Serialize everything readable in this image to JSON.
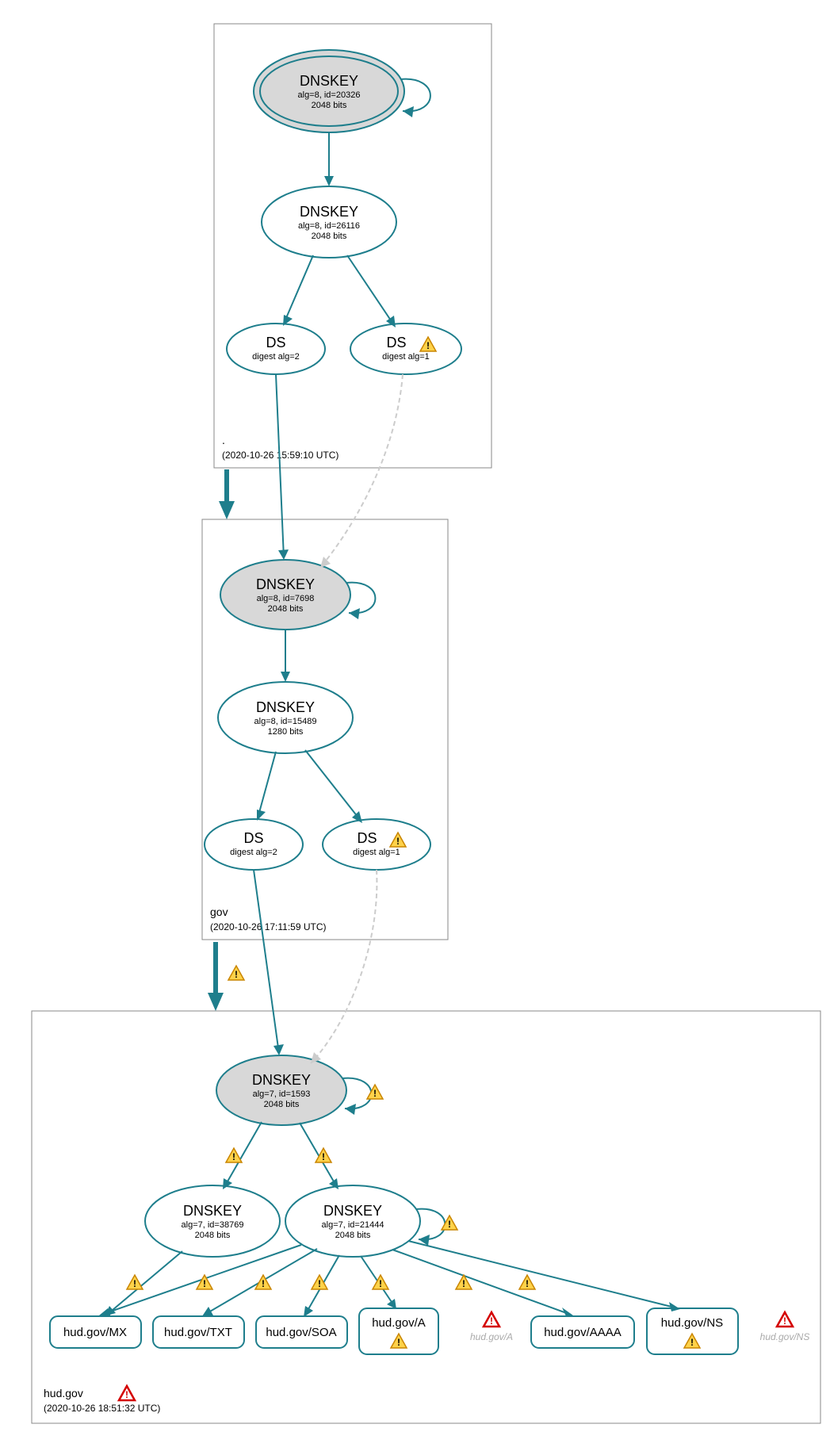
{
  "zones": {
    "root": {
      "label": ".",
      "timestamp": "(2020-10-26 15:59:10 UTC)"
    },
    "gov": {
      "label": "gov",
      "timestamp": "(2020-10-26 17:11:59 UTC)"
    },
    "hud": {
      "label": "hud.gov",
      "timestamp": "(2020-10-26 18:51:32 UTC)"
    }
  },
  "nodes": {
    "rootKSK": {
      "l1": "DNSKEY",
      "l2": "alg=8, id=20326",
      "l3": "2048 bits"
    },
    "rootZSK": {
      "l1": "DNSKEY",
      "l2": "alg=8, id=26116",
      "l3": "2048 bits"
    },
    "rootDS1": {
      "l1": "DS",
      "l2": "digest alg=2"
    },
    "rootDS2": {
      "l1": "DS",
      "l2": "digest alg=1"
    },
    "govKSK": {
      "l1": "DNSKEY",
      "l2": "alg=8, id=7698",
      "l3": "2048 bits"
    },
    "govZSK": {
      "l1": "DNSKEY",
      "l2": "alg=8, id=15489",
      "l3": "1280 bits"
    },
    "govDS1": {
      "l1": "DS",
      "l2": "digest alg=2"
    },
    "govDS2": {
      "l1": "DS",
      "l2": "digest alg=1"
    },
    "hudKSK": {
      "l1": "DNSKEY",
      "l2": "alg=7, id=1593",
      "l3": "2048 bits"
    },
    "hudZ1": {
      "l1": "DNSKEY",
      "l2": "alg=7, id=38769",
      "l3": "2048 bits"
    },
    "hudZ2": {
      "l1": "DNSKEY",
      "l2": "alg=7, id=21444",
      "l3": "2048 bits"
    },
    "rrMX": {
      "l": "hud.gov/MX"
    },
    "rrTXT": {
      "l": "hud.gov/TXT"
    },
    "rrSOA": {
      "l": "hud.gov/SOA"
    },
    "rrA": {
      "l": "hud.gov/A"
    },
    "rrAAAA": {
      "l": "hud.gov/AAAA"
    },
    "rrNS": {
      "l": "hud.gov/NS"
    },
    "ghA": {
      "l": "hud.gov/A"
    },
    "ghNS": {
      "l": "hud.gov/NS"
    }
  }
}
